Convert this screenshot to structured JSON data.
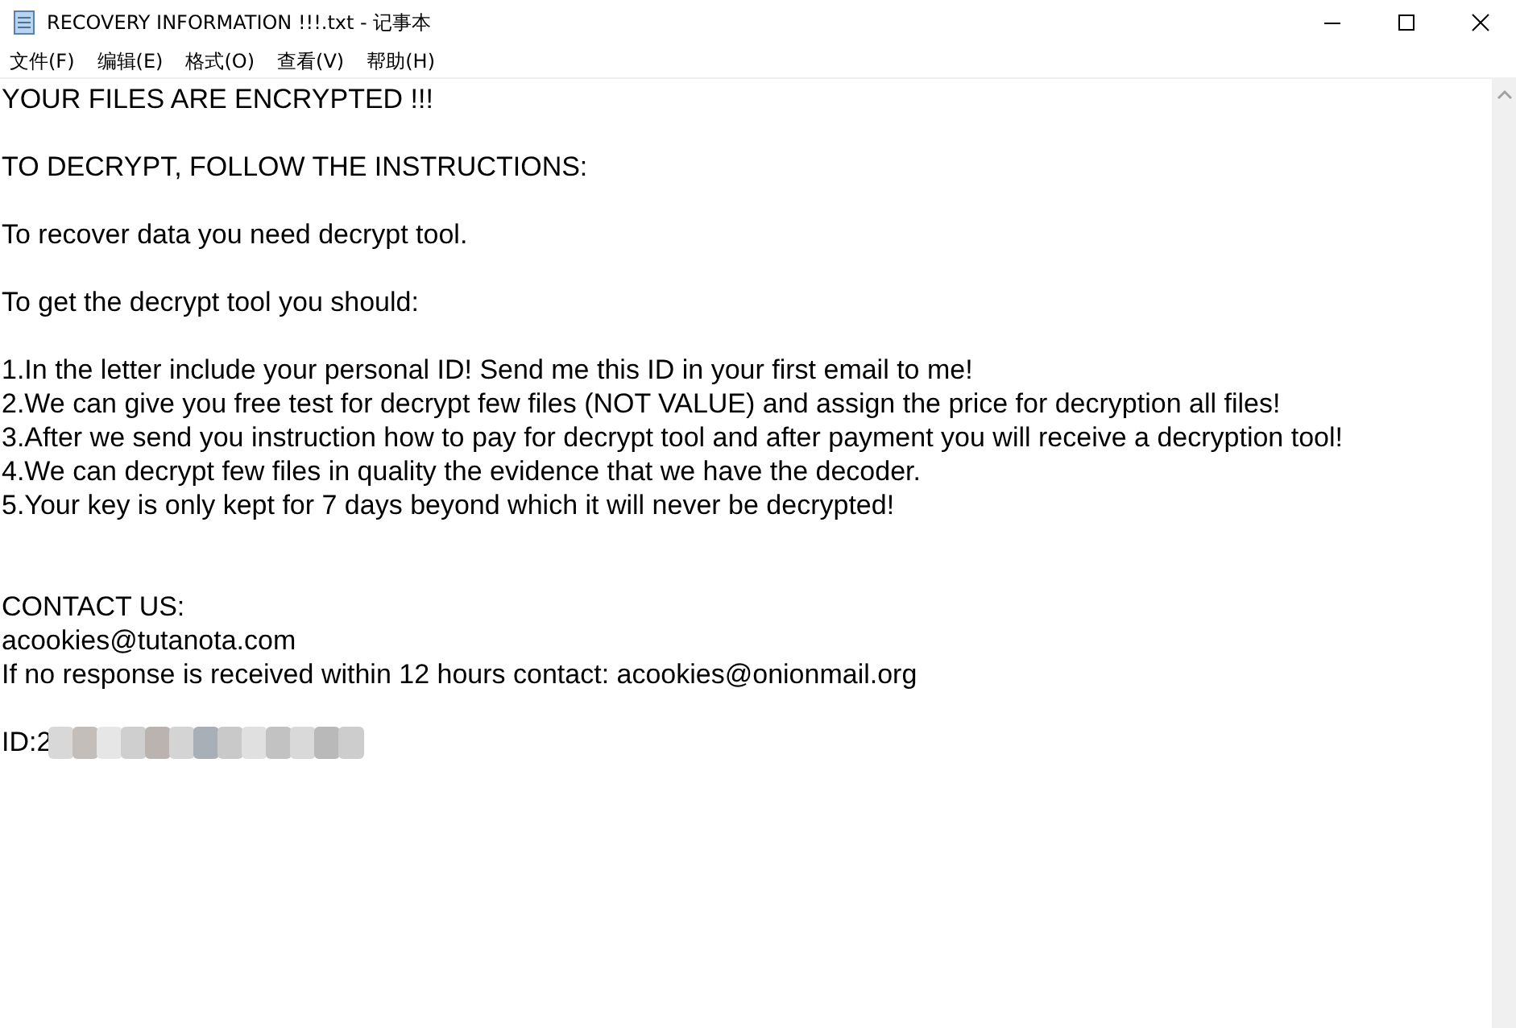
{
  "window": {
    "title": "RECOVERY INFORMATION !!!.txt - 记事本"
  },
  "menu": [
    "文件(F)",
    "编辑(E)",
    "格式(O)",
    "查看(V)",
    "帮助(H)"
  ],
  "document": {
    "text": "YOUR FILES ARE ENCRYPTED !!!\n\nTO DECRYPT, FOLLOW THE INSTRUCTIONS:\n\nTo recover data you need decrypt tool.\n\nTo get the decrypt tool you should:\n\n1.In the letter include your personal ID! Send me this ID in your first email to me!\n2.We can give you free test for decrypt few files (NOT VALUE) and assign the price for decryption all files!\n3.After we send you instruction how to pay for decrypt tool and after payment you will receive a decryption tool!\n4.We can decrypt few files in quality the evidence that we have the decoder.\n5.Your key is only kept for 7 days beyond which it will never be decrypted!\n\n\nCONTACT US:\nacookies@tutanota.com\nIf no response is received within 12 hours contact: acookies@onionmail.org\n",
    "id_label": "ID:2"
  }
}
